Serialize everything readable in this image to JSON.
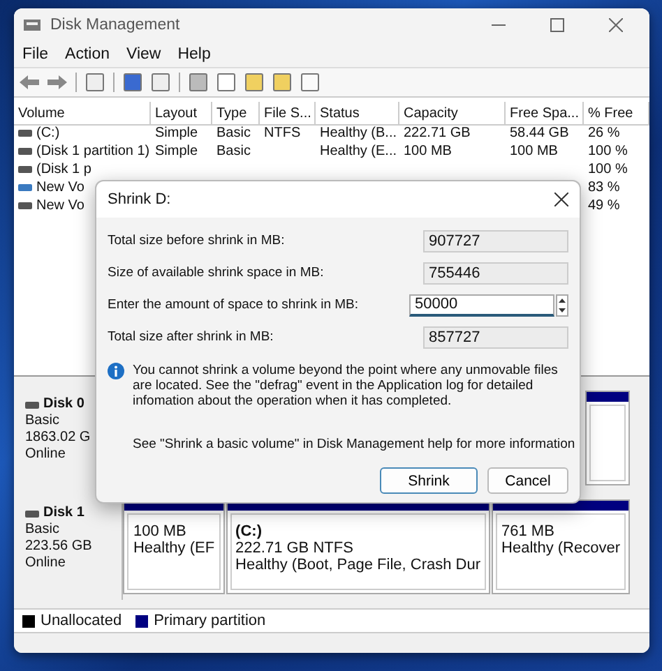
{
  "window": {
    "title": "Disk Management"
  },
  "menu": [
    "File",
    "Action",
    "View",
    "Help"
  ],
  "table": {
    "columns": [
      "Volume",
      "Layout",
      "Type",
      "File S...",
      "Status",
      "Capacity",
      "Free Spa...",
      "% Free"
    ],
    "rows": [
      {
        "cells": [
          "(C:)",
          "Simple",
          "Basic",
          "NTFS",
          "Healthy (B...",
          "222.71 GB",
          "58.44 GB",
          "26 %"
        ],
        "kind": "plain"
      },
      {
        "cells": [
          "(Disk 1 partition 1)",
          "Simple",
          "Basic",
          "",
          "Healthy (E...",
          "100 MB",
          "100 MB",
          "100 %"
        ],
        "kind": "plain"
      },
      {
        "cells": [
          "(Disk 1 p",
          "",
          "",
          "",
          "",
          "",
          "",
          "100 %"
        ],
        "kind": "plain"
      },
      {
        "cells": [
          "New Vo",
          "",
          "",
          "",
          "",
          "",
          "",
          "83 %"
        ],
        "kind": "striped"
      },
      {
        "cells": [
          "New Vo",
          "",
          "",
          "",
          "",
          "",
          "",
          "49 %"
        ],
        "kind": "plain"
      }
    ]
  },
  "disks": [
    {
      "name": "Disk 0",
      "lines": [
        "Basic",
        "1863.02 G",
        "Online"
      ],
      "partitions": [
        {
          "kind": "stub"
        }
      ]
    },
    {
      "name": "Disk 1",
      "lines": [
        "Basic",
        "223.56 GB",
        "Online"
      ],
      "partitions": [
        {
          "lines": [
            "100 MB",
            "Healthy (EF"
          ],
          "kind": "narrow"
        },
        {
          "title": "(C:)",
          "lines": [
            "222.71 GB NTFS",
            "Healthy (Boot, Page File, Crash Dur"
          ],
          "kind": "wide"
        },
        {
          "lines": [
            "761 MB",
            "Healthy (Recover"
          ],
          "kind": "medium"
        }
      ]
    }
  ],
  "legend": [
    {
      "label": "Unallocated",
      "color": "#000000"
    },
    {
      "label": "Primary partition",
      "color": "#000080"
    }
  ],
  "dialog": {
    "title": "Shrink D:",
    "fields": [
      {
        "label": "Total size before shrink in MB:",
        "value": "907727",
        "kind": "readonly"
      },
      {
        "label": "Size of available shrink space in MB:",
        "value": "755446",
        "kind": "readonly"
      },
      {
        "label": "Enter the amount of space to shrink in MB:",
        "value": "50000",
        "kind": "spin"
      },
      {
        "label": "Total size after shrink in MB:",
        "value": "857727",
        "kind": "readonly"
      }
    ],
    "info": "You cannot shrink a volume beyond the point where any unmovable files are located. See the \"defrag\" event in the Application log for detailed infomation about the operation when it has completed.",
    "help": "See \"Shrink a basic volume\" in Disk Management help for more information",
    "buttons": [
      {
        "label": "Shrink",
        "selected": true
      },
      {
        "label": "Cancel",
        "selected": false
      }
    ]
  }
}
